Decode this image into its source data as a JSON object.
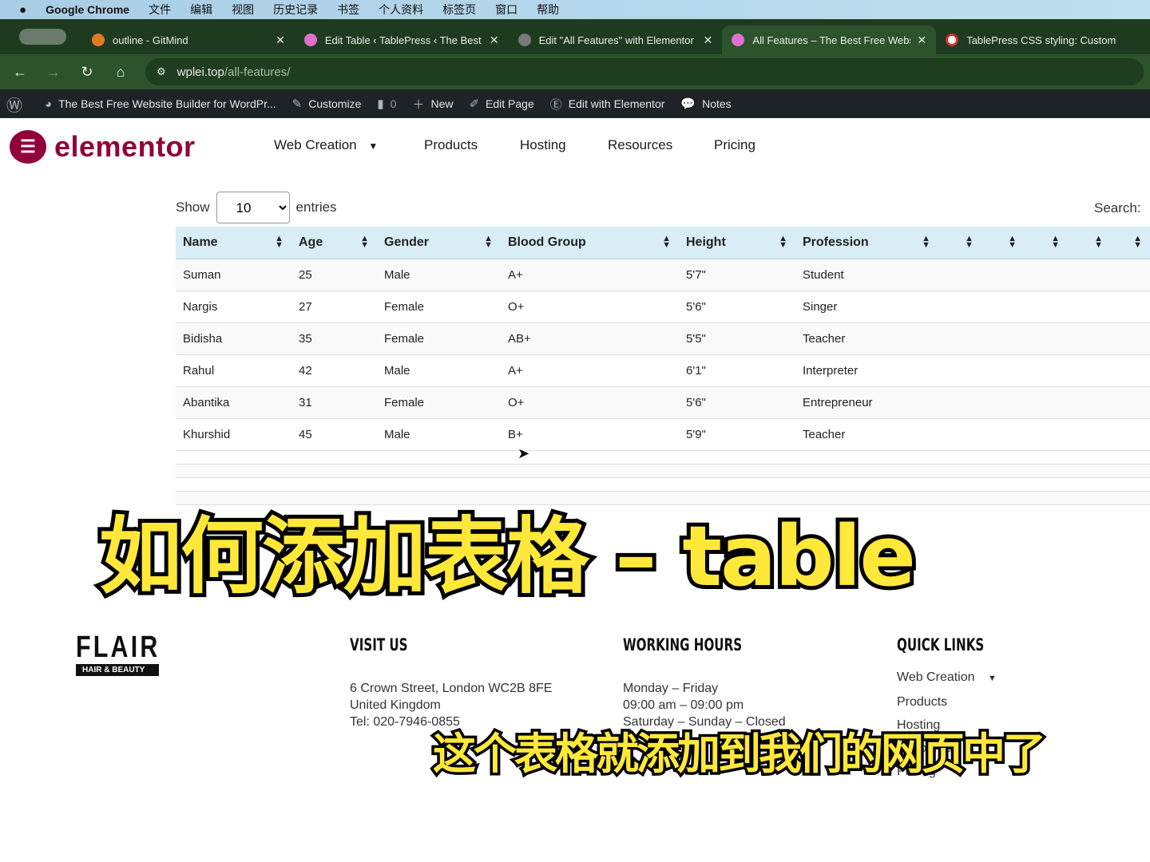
{
  "menubar": {
    "app": "Google Chrome",
    "items": [
      "文件",
      "编辑",
      "视图",
      "历史记录",
      "书签",
      "个人资料",
      "标签页",
      "窗口",
      "帮助"
    ]
  },
  "tabs": [
    {
      "title": "outline - GitMind",
      "color": "#e07b1f",
      "active": false
    },
    {
      "title": "Edit Table ‹ TablePress ‹ The Best",
      "color": "#e06fcf",
      "active": false
    },
    {
      "title": "Edit \"All Features\" with Elementor",
      "color": "#7a7a7a",
      "active": false
    },
    {
      "title": "All Features – The Best Free Website",
      "color": "#e06fcf",
      "active": true
    },
    {
      "title": "TablePress CSS styling: Custom",
      "color": "#c33",
      "active": false
    }
  ],
  "address": {
    "domain": "wplei.top",
    "path": "/all-features/"
  },
  "wpbar": {
    "site": "The Best Free Website Builder for WordPr...",
    "customize": "Customize",
    "comments": "0",
    "new": "New",
    "edit_page": "Edit Page",
    "edit_elementor": "Edit with Elementor",
    "notes": "Notes"
  },
  "site": {
    "logo": "elementor",
    "nav": [
      "Web Creation",
      "Products",
      "Hosting",
      "Resources",
      "Pricing"
    ]
  },
  "table": {
    "show_label": "Show",
    "entries_value": "10",
    "entries_label": "entries",
    "search_label": "Search:",
    "headers": [
      "Name",
      "Age",
      "Gender",
      "Blood Group",
      "Height",
      "Profession",
      "",
      "",
      "",
      "",
      ""
    ],
    "rows": [
      [
        "Suman",
        "25",
        "Male",
        "A+",
        "5'7\"",
        "Student"
      ],
      [
        "Nargis",
        "27",
        "Female",
        "O+",
        "5'6\"",
        "Singer"
      ],
      [
        "Bidisha",
        "35",
        "Female",
        "AB+",
        "5'5\"",
        "Teacher"
      ],
      [
        "Rahul",
        "42",
        "Male",
        "A+",
        "6'1\"",
        "Interpreter"
      ],
      [
        "Abantika",
        "31",
        "Female",
        "O+",
        "5'6\"",
        "Entrepreneur"
      ],
      [
        "Khurshid",
        "45",
        "Male",
        "B+",
        "5'9\"",
        "Teacher"
      ]
    ]
  },
  "captions": {
    "title": "如何添加表格 – table",
    "subtitle": "这个表格就添加到我们的网页中了"
  },
  "footer": {
    "brand": "FLAIR",
    "brand_sub": "HAIR & BEAUTY",
    "visit": {
      "heading": "VISIT US",
      "lines": [
        "6 Crown Street, London WC2B 8FE",
        "United Kingdom",
        "Tel: 020-7946-0855"
      ]
    },
    "hours": {
      "heading": "WORKING HOURS",
      "lines": [
        "Monday – Friday",
        "09:00 am – 09:00 pm",
        "Saturday – Sunday – Closed"
      ]
    },
    "links": {
      "heading": "QUICK LINKS",
      "items": [
        "Web Creation",
        "Products",
        "Hosting",
        "Resources",
        "Pricing"
      ]
    }
  }
}
